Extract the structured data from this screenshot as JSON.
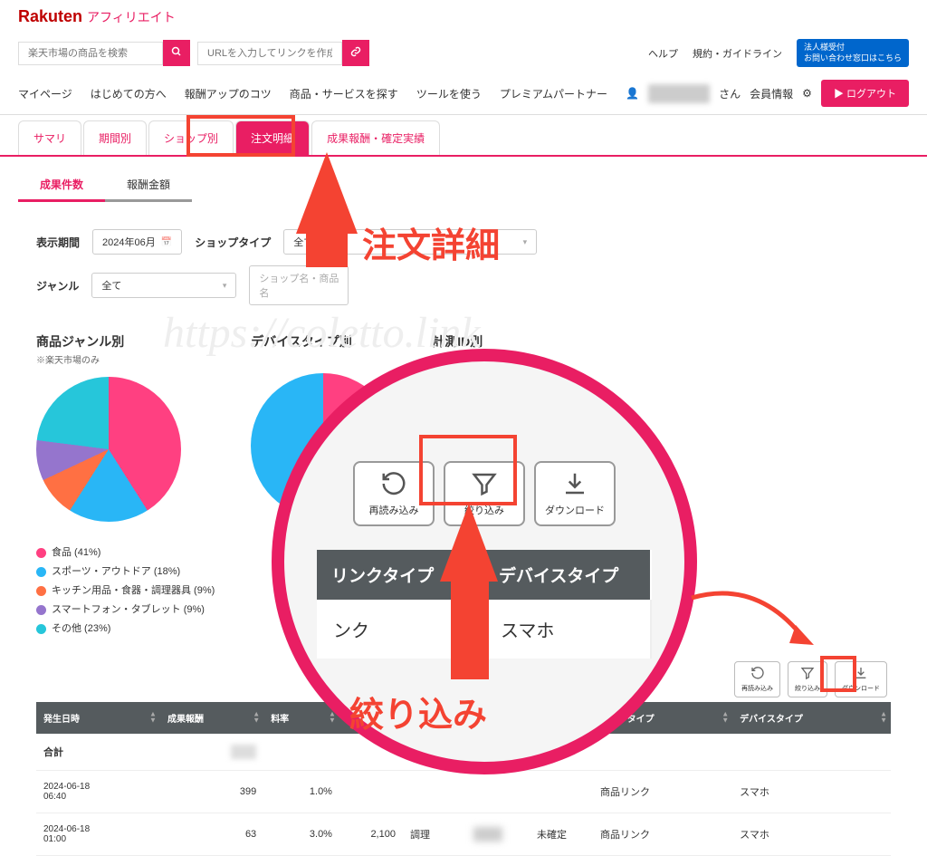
{
  "header": {
    "logo_main": "Rakuten",
    "logo_sub": "アフィリエイト",
    "search1_placeholder": "楽天市場の商品を検索",
    "search2_placeholder": "URLを入力してリンクを作成",
    "help": "ヘルプ",
    "terms": "規約・ガイドライン",
    "contact_top": "法人様受付",
    "contact_bottom": "お問い合わせ窓口はこちら"
  },
  "nav": {
    "items": [
      "マイページ",
      "はじめての方へ",
      "報酬アップのコツ",
      "商品・サービスを探す",
      "ツールを使う",
      "プレミアムパートナー"
    ],
    "user_suffix": "さん",
    "member_info": "会員情報",
    "logout": "ログアウト"
  },
  "tabs": [
    "サマリ",
    "期間別",
    "ショップ別",
    "注文明細",
    "成果報酬・確定実績"
  ],
  "active_tab": 3,
  "subtabs": [
    "成果件数",
    "報酬金額"
  ],
  "active_subtab": 0,
  "filters": {
    "period_label": "表示期間",
    "period_value": "2024年06月",
    "shoptype_label": "ショップタイプ",
    "shoptype_value": "全て",
    "genre_label": "ジャンル",
    "genre_value": "全て",
    "keyword_placeholder": "ショップ名・商品名"
  },
  "charts": {
    "c1": {
      "title": "商品ジャンル別",
      "sub": "※楽天市場のみ"
    },
    "c2": {
      "title": "デバイスタイプ別"
    },
    "c3": {
      "title": "計測ID別"
    }
  },
  "legend": [
    {
      "color": "#ff4081",
      "label": "食品 (41%)"
    },
    {
      "color": "#29b6f6",
      "label": "スポーツ・アウトドア (18%)"
    },
    {
      "color": "#ff7043",
      "label": "キッチン用品・食器・調理器具 (9%)"
    },
    {
      "color": "#9575cd",
      "label": "スマートフォン・タブレット (9%)"
    },
    {
      "color": "#26c6da",
      "label": "その他 (23%)"
    }
  ],
  "chart_data": {
    "type": "pie",
    "title": "商品ジャンル別",
    "series": [
      {
        "name": "食品",
        "value": 41
      },
      {
        "name": "スポーツ・アウトドア",
        "value": 18
      },
      {
        "name": "キッチン用品・食器・調理器具",
        "value": 9
      },
      {
        "name": "スマートフォン・タブレット",
        "value": 9
      },
      {
        "name": "その他",
        "value": 23
      }
    ]
  },
  "zoom": {
    "reload": "再読み込み",
    "filter": "絞り込み",
    "download": "ダウンロード",
    "th1": "リンクタイプ",
    "th2": "デバイスタイプ",
    "td1": "ンク",
    "td2": "スマホ"
  },
  "annotations": {
    "order_detail": "注文詳細",
    "filter_label": "絞り込み"
  },
  "mini_toolbar": {
    "reload": "再読み込み",
    "filter": "絞り込み",
    "download": "ダウンロード"
  },
  "table": {
    "headers": [
      "発生日時",
      "成果報酬",
      "料率",
      "",
      "",
      "",
      "",
      "リンクタイプ",
      "デバイスタイプ"
    ],
    "rows": [
      {
        "date": "合計",
        "reward": "",
        "rate": "",
        "c4": "",
        "c5": "",
        "c6": "",
        "c7": "",
        "link": "",
        "device": ""
      },
      {
        "date": "2024-06-18\n06:40",
        "reward": "399",
        "rate": "1.0%",
        "c4": "",
        "c5": "",
        "c6": "",
        "c7": "",
        "link": "商品リンク",
        "device": "スマホ"
      },
      {
        "date": "2024-06-18\n01:00",
        "reward": "63",
        "rate": "3.0%",
        "c4": "2,100",
        "c5": "調理",
        "c6": "",
        "c7": "未確定",
        "link": "商品リンク",
        "device": "スマホ"
      }
    ]
  },
  "watermark": "https://coletto.link"
}
